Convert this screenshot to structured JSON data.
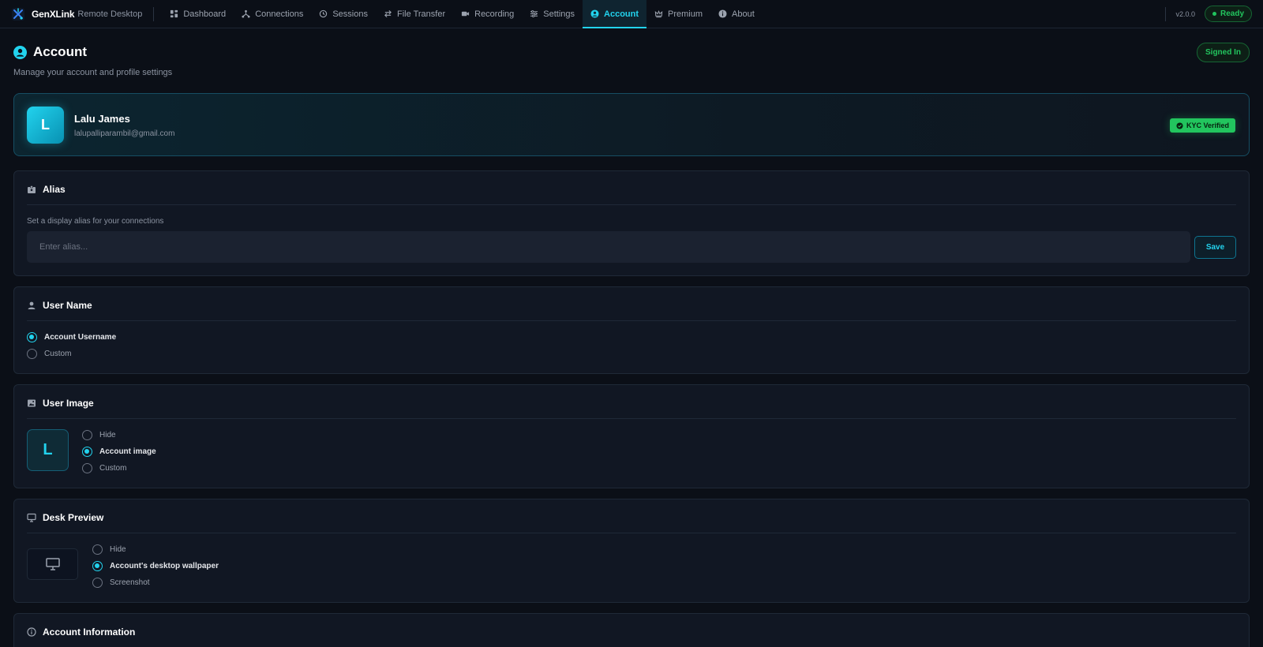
{
  "app": {
    "name": "GenXLink",
    "subtitle": "Remote Desktop",
    "version": "v2.0.0",
    "status": "Ready"
  },
  "nav": {
    "items": [
      {
        "label": "Dashboard",
        "icon": "dashboard-icon"
      },
      {
        "label": "Connections",
        "icon": "connections-icon"
      },
      {
        "label": "Sessions",
        "icon": "history-icon"
      },
      {
        "label": "File Transfer",
        "icon": "transfer-icon"
      },
      {
        "label": "Recording",
        "icon": "video-icon"
      },
      {
        "label": "Settings",
        "icon": "sliders-icon"
      },
      {
        "label": "Account",
        "icon": "user-circle-icon",
        "active": true
      },
      {
        "label": "Premium",
        "icon": "crown-icon"
      },
      {
        "label": "About",
        "icon": "info-icon"
      }
    ]
  },
  "page": {
    "title": "Account",
    "subtitle": "Manage your account and profile settings",
    "signed_in": "Signed In"
  },
  "profile": {
    "initial": "L",
    "name": "Lalu James",
    "email": "lalupalliparambil@gmail.com",
    "kyc": "KYC Verified"
  },
  "alias": {
    "title": "Alias",
    "hint": "Set a display alias for your connections",
    "placeholder": "Enter alias...",
    "value": "",
    "save_label": "Save"
  },
  "user_name": {
    "title": "User Name",
    "options": [
      "Account Username",
      "Custom"
    ],
    "selected": "Account Username"
  },
  "user_image": {
    "title": "User Image",
    "initial": "L",
    "options": [
      "Hide",
      "Account image",
      "Custom"
    ],
    "selected": "Account image"
  },
  "desk_preview": {
    "title": "Desk Preview",
    "options": [
      "Hide",
      "Account's desktop wallpaper",
      "Screenshot"
    ],
    "selected": "Account's desktop wallpaper"
  },
  "account_info": {
    "title": "Account Information"
  },
  "colors": {
    "accent": "#22d3ee",
    "success": "#22c55e",
    "background": "#0b0f17",
    "card": "#111723"
  }
}
